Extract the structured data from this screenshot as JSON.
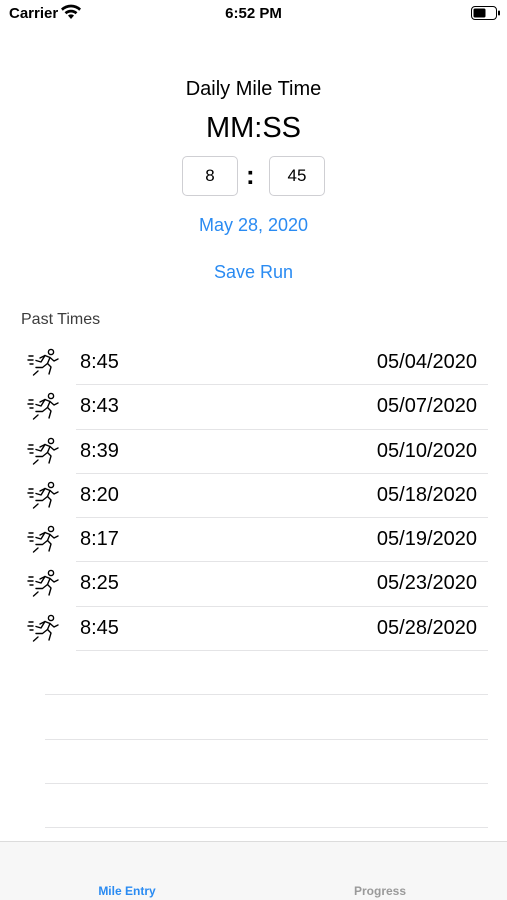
{
  "status_bar": {
    "carrier": "Carrier",
    "time": "6:52 PM"
  },
  "entry": {
    "title": "Daily Mile Time",
    "format_label": "MM:SS",
    "minutes_value": "8",
    "seconds_value": "45",
    "separator": ":",
    "date": "May 28, 2020",
    "save_label": "Save Run"
  },
  "past_times": {
    "header": "Past Times",
    "icon": "running-person-icon",
    "rows": [
      {
        "time": "8:45",
        "date": "05/04/2020"
      },
      {
        "time": "8:43",
        "date": "05/07/2020"
      },
      {
        "time": "8:39",
        "date": "05/10/2020"
      },
      {
        "time": "8:20",
        "date": "05/18/2020"
      },
      {
        "time": "8:17",
        "date": "05/19/2020"
      },
      {
        "time": "8:25",
        "date": "05/23/2020"
      },
      {
        "time": "8:45",
        "date": "05/28/2020"
      }
    ]
  },
  "tab_bar": {
    "tabs": [
      {
        "label": "Mile Entry",
        "selected": true
      },
      {
        "label": "Progress",
        "selected": false
      }
    ]
  },
  "colors": {
    "accent": "#2a8bf2",
    "inactive_tab": "#9a9a9a"
  }
}
